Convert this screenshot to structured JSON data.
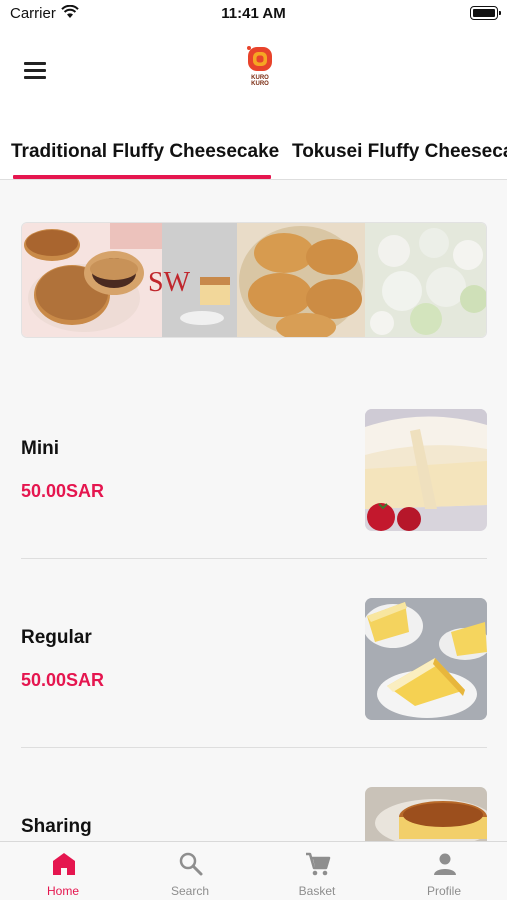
{
  "status_bar": {
    "carrier": "Carrier",
    "time": "11:41 AM"
  },
  "header": {
    "logo_text_top": "KURO",
    "logo_text_bottom": "KURO"
  },
  "tabs": [
    {
      "label": "Traditional Fluffy Cheesecake",
      "active": true
    },
    {
      "label": "Tokusei Fluffy Cheesecake",
      "active": false
    }
  ],
  "banner": {
    "overlay_text": "SW"
  },
  "products": [
    {
      "name": "Mini",
      "price": "50.00SAR"
    },
    {
      "name": "Regular",
      "price": "50.00SAR"
    },
    {
      "name": "Sharing",
      "price": ""
    }
  ],
  "bottom_nav": [
    {
      "label": "Home",
      "icon": "home-icon",
      "active": true
    },
    {
      "label": "Search",
      "icon": "search-icon",
      "active": false
    },
    {
      "label": "Basket",
      "icon": "cart-icon",
      "active": false
    },
    {
      "label": "Profile",
      "icon": "person-icon",
      "active": false
    }
  ],
  "colors": {
    "accent": "#e5164f",
    "inactive": "#8e8e8e",
    "logo_red": "#e8432b",
    "logo_orange": "#f5a623"
  }
}
